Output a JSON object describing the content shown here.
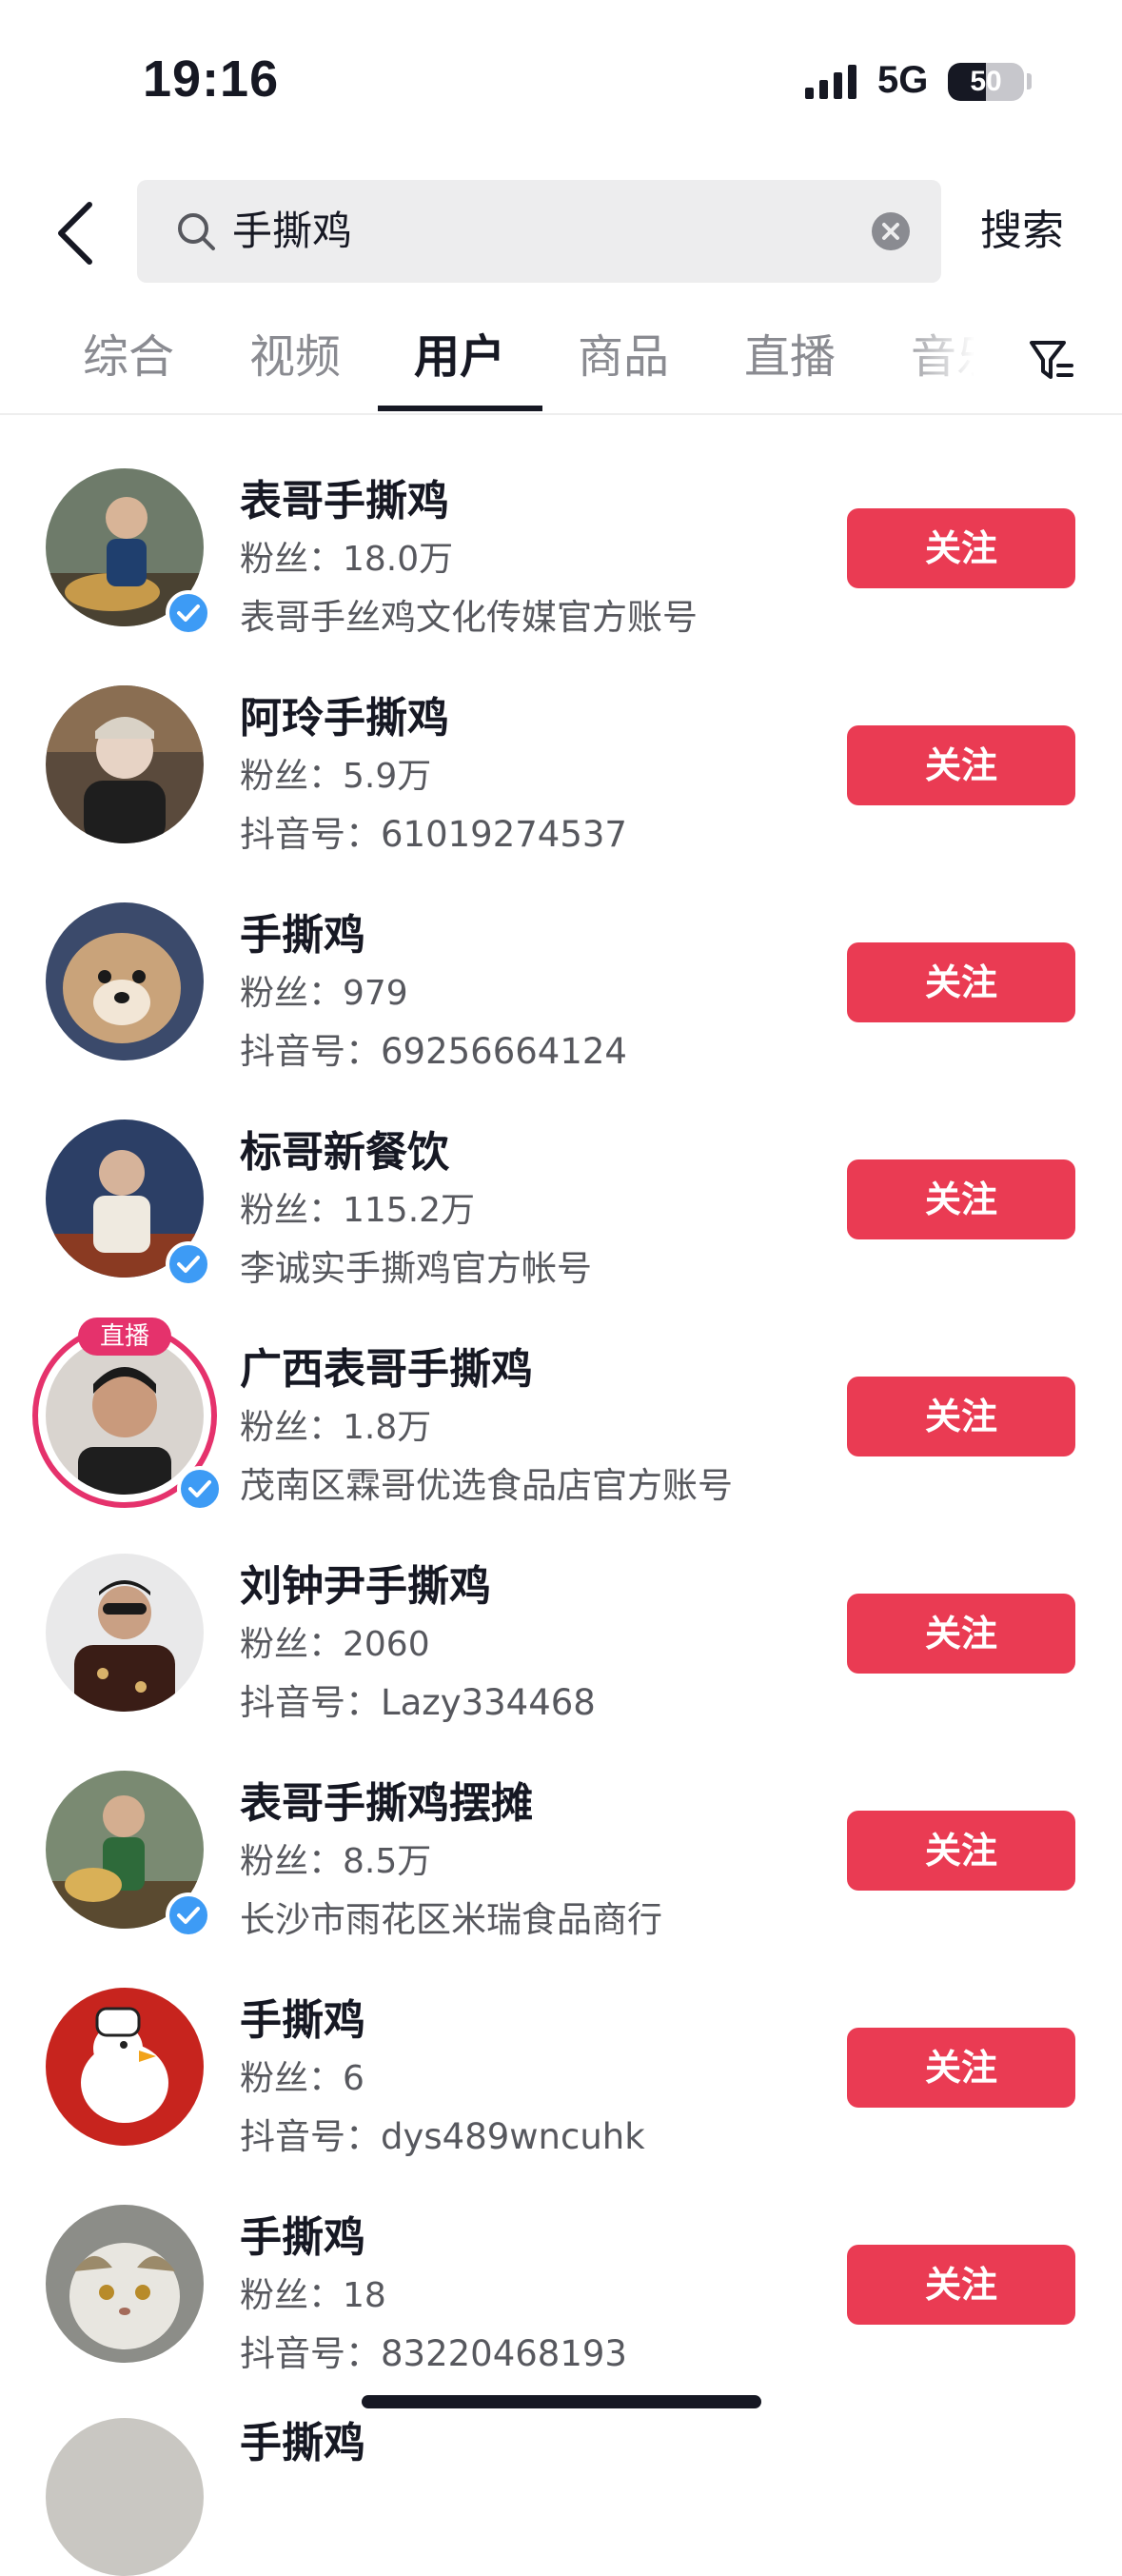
{
  "status_bar": {
    "time": "19:16",
    "network": "5G",
    "battery": "50"
  },
  "search": {
    "query": "手撕鸡",
    "submit_label": "搜索"
  },
  "tabs": [
    {
      "label": "综合",
      "active": false
    },
    {
      "label": "视频",
      "active": false
    },
    {
      "label": "用户",
      "active": true
    },
    {
      "label": "商品",
      "active": false
    },
    {
      "label": "直播",
      "active": false
    },
    {
      "label": "音乐",
      "active": false
    }
  ],
  "users": [
    {
      "name": "表哥手撕鸡",
      "followers": "粉丝：18.0万",
      "desc": "表哥手丝鸡文化传媒官方账号",
      "follow_label": "关注",
      "verified": true,
      "live": false,
      "live_label": ""
    },
    {
      "name": "阿玲手撕鸡",
      "followers": "粉丝：5.9万",
      "desc": "抖音号：61019274537",
      "follow_label": "关注",
      "verified": false,
      "live": false,
      "live_label": ""
    },
    {
      "name": "手撕鸡",
      "followers": "粉丝：979",
      "desc": "抖音号：69256664124",
      "follow_label": "关注",
      "verified": false,
      "live": false,
      "live_label": ""
    },
    {
      "name": "标哥新餐饮",
      "followers": "粉丝：115.2万",
      "desc": "李诚实手撕鸡官方帐号",
      "follow_label": "关注",
      "verified": true,
      "live": false,
      "live_label": ""
    },
    {
      "name": "广西表哥手撕鸡",
      "followers": "粉丝：1.8万",
      "desc": "茂南区霖哥优选食品店官方账号",
      "follow_label": "关注",
      "verified": true,
      "live": true,
      "live_label": "直播"
    },
    {
      "name": "刘钟尹手撕鸡",
      "followers": "粉丝：2060",
      "desc": "抖音号：Lazy334468",
      "follow_label": "关注",
      "verified": false,
      "live": false,
      "live_label": ""
    },
    {
      "name": "表哥手撕鸡摆摊",
      "followers": "粉丝：8.5万",
      "desc": "长沙市雨花区米瑞食品商行",
      "follow_label": "关注",
      "verified": true,
      "live": false,
      "live_label": ""
    },
    {
      "name": "手撕鸡",
      "followers": "粉丝：6",
      "desc": "抖音号：dys489wncuhk",
      "follow_label": "关注",
      "verified": false,
      "live": false,
      "live_label": ""
    },
    {
      "name": "手撕鸡",
      "followers": "粉丝：18",
      "desc": "抖音号：83220468193",
      "follow_label": "关注",
      "verified": false,
      "live": false,
      "live_label": ""
    }
  ],
  "partial_next_name": "手撕鸡",
  "colors": {
    "accent": "#ea3b53",
    "live": "#e5326c",
    "verified": "#3d9bf5"
  }
}
